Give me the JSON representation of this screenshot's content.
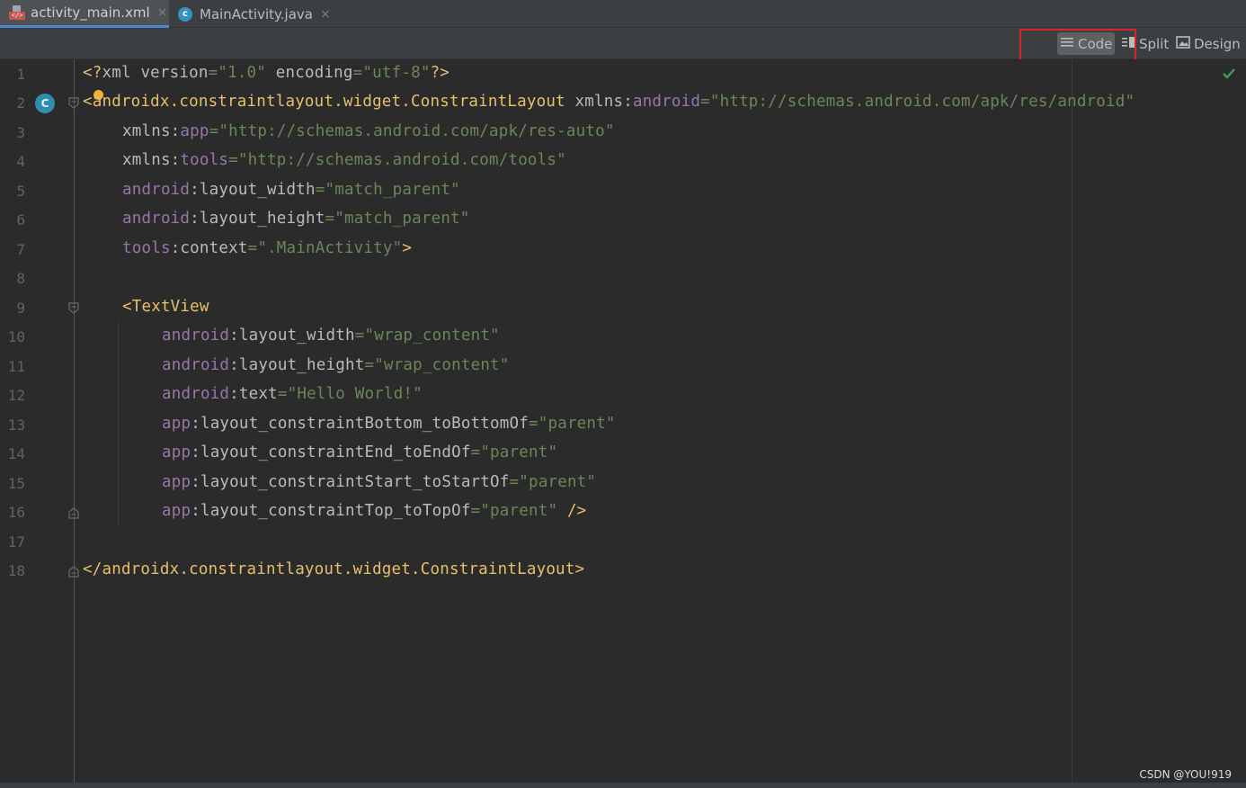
{
  "tabs": [
    {
      "label": "activity_main.xml",
      "icon": "xml-file-icon",
      "active": true
    },
    {
      "label": "MainActivity.java",
      "icon": "java-class-icon",
      "active": false
    }
  ],
  "tab_close": "×",
  "toolbar": {
    "code_label": "Code",
    "split_label": "Split",
    "design_label": "Design"
  },
  "colors": {
    "tag": "#e8bf6a",
    "namespace": "#9876aa",
    "string": "#6a8759",
    "highlight_box": "#e0202a"
  },
  "gutter": {
    "class_marker": "C"
  },
  "editor": {
    "lines": [
      {
        "no": "1"
      },
      {
        "no": "2"
      },
      {
        "no": "3"
      },
      {
        "no": "4"
      },
      {
        "no": "5"
      },
      {
        "no": "6"
      },
      {
        "no": "7"
      },
      {
        "no": "8"
      },
      {
        "no": "9"
      },
      {
        "no": "10"
      },
      {
        "no": "11"
      },
      {
        "no": "12"
      },
      {
        "no": "13"
      },
      {
        "no": "14"
      },
      {
        "no": "15"
      },
      {
        "no": "16"
      },
      {
        "no": "17"
      },
      {
        "no": "18"
      }
    ],
    "code": {
      "l1": {
        "open": "<?",
        "xml": "xml",
        "ver_attr": " version",
        "eq": "=",
        "ver_val": "\"1.0\"",
        "enc_attr": " encoding",
        "enc_val": "\"utf-8\"",
        "close": "?>"
      },
      "l2": {
        "tag": "<androidx.constraintlayout.widget.ConstraintLayout",
        "xmlns": " xmlns:",
        "ns": "android",
        "val": "\"http://schemas.android.com/apk/res/android\""
      },
      "l3": {
        "xmlns": "xmlns:",
        "ns": "app",
        "val": "\"http://schemas.android.com/apk/res-auto\""
      },
      "l4": {
        "xmlns": "xmlns:",
        "ns": "tools",
        "val": "\"http://schemas.android.com/tools\""
      },
      "l5": {
        "ns": "android",
        "attr": ":layout_width",
        "val": "\"match_parent\""
      },
      "l6": {
        "ns": "android",
        "attr": ":layout_height",
        "val": "\"match_parent\""
      },
      "l7": {
        "ns": "tools",
        "attr": ":context",
        "val": "\".MainActivity\"",
        "close": ">"
      },
      "l9": {
        "tag": "<TextView"
      },
      "l10": {
        "ns": "android",
        "attr": ":layout_width",
        "val": "\"wrap_content\""
      },
      "l11": {
        "ns": "android",
        "attr": ":layout_height",
        "val": "\"wrap_content\""
      },
      "l12": {
        "ns": "android",
        "attr": ":text",
        "val": "\"Hello World!\""
      },
      "l13": {
        "ns": "app",
        "attr": ":layout_constraintBottom_toBottomOf",
        "val": "\"parent\""
      },
      "l14": {
        "ns": "app",
        "attr": ":layout_constraintEnd_toEndOf",
        "val": "\"parent\""
      },
      "l15": {
        "ns": "app",
        "attr": ":layout_constraintStart_toStartOf",
        "val": "\"parent\""
      },
      "l16": {
        "ns": "app",
        "attr": ":layout_constraintTop_toTopOf",
        "val": "\"parent\"",
        "close": " />"
      },
      "l18": {
        "tag": "</androidx.constraintlayout.widget.ConstraintLayout>"
      }
    }
  },
  "watermark": "CSDN @YOU!919"
}
